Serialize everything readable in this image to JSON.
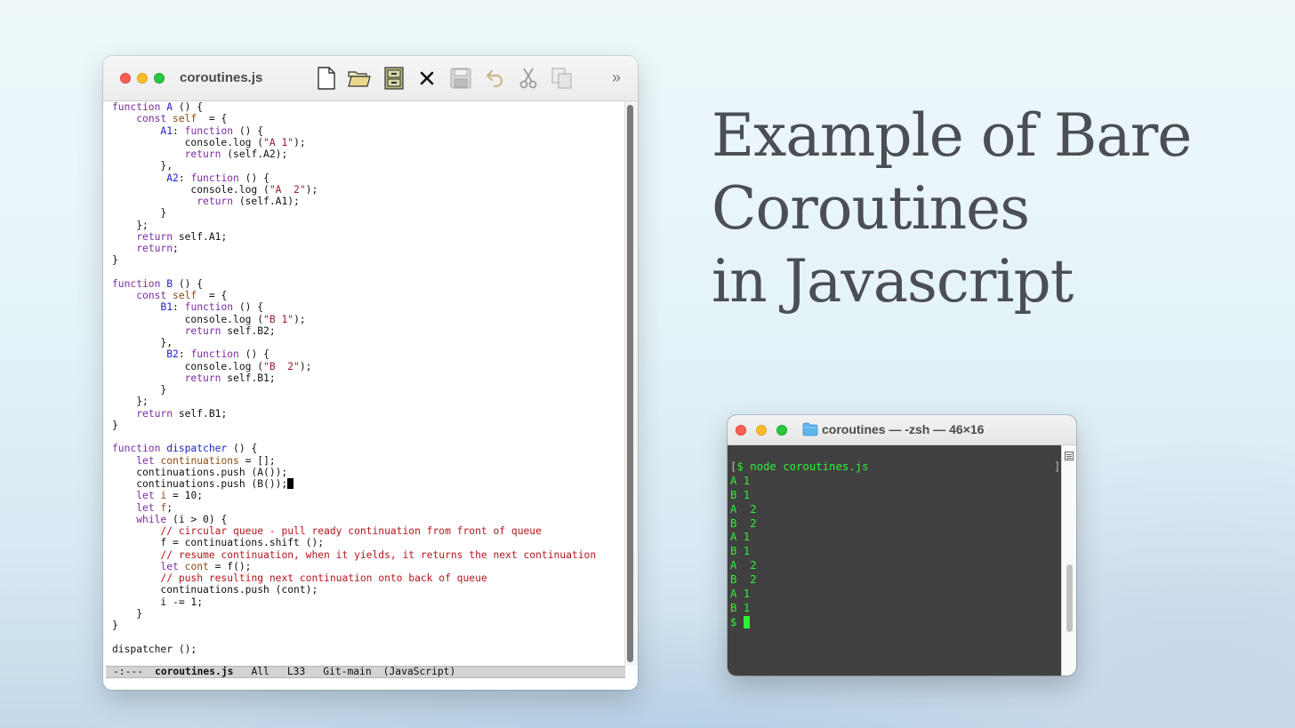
{
  "editor": {
    "title": "coroutines.js",
    "code_lines": [
      [
        [
          "kw",
          "function "
        ],
        [
          "fn",
          "A"
        ],
        [
          "",
          "  () {"
        ]
      ],
      [
        [
          "",
          "    "
        ],
        [
          "kw",
          "const "
        ],
        [
          "var",
          "self"
        ],
        [
          "",
          ""
        ],
        [
          "",
          ""
        ],
        [
          "",
          "  = {"
        ]
      ],
      [
        [
          "",
          "        "
        ],
        [
          "fn",
          "A1"
        ],
        [
          "",
          ": "
        ],
        [
          "kw",
          "function"
        ],
        [
          "",
          "  () {"
        ]
      ],
      [
        [
          "",
          "            console.log ("
        ],
        [
          "str",
          "\"A 1\""
        ],
        [
          "",
          ");"
        ]
      ],
      [
        [
          "",
          "            "
        ],
        [
          "kw",
          "return"
        ],
        [
          "",
          " (self.A2);"
        ]
      ],
      [
        [
          "",
          "        },"
        ]
      ],
      [
        [
          "",
          "         "
        ],
        [
          "fn",
          "A2"
        ],
        [
          "",
          ": "
        ],
        [
          "kw",
          "function"
        ],
        [
          "",
          "  () {"
        ]
      ],
      [
        [
          "",
          "             console.log ("
        ],
        [
          "str",
          "\"A  2\""
        ],
        [
          "",
          ");"
        ]
      ],
      [
        [
          "",
          "              "
        ],
        [
          "kw",
          "return"
        ],
        [
          "",
          " (self.A1);"
        ]
      ],
      [
        [
          "",
          "        }"
        ]
      ],
      [
        [
          "",
          "    };"
        ]
      ],
      [
        [
          "",
          "    "
        ],
        [
          "kw",
          "return"
        ],
        [
          "",
          " self.A1;"
        ]
      ],
      [
        [
          "",
          "    "
        ],
        [
          "kw",
          "return"
        ],
        [
          "",
          ";"
        ]
      ],
      [
        [
          "",
          "}"
        ]
      ],
      [
        [
          "",
          ""
        ]
      ],
      [
        [
          "kw",
          "function "
        ],
        [
          "fn",
          "B"
        ],
        [
          "",
          "  () {"
        ]
      ],
      [
        [
          "",
          "    "
        ],
        [
          "kw",
          "const "
        ],
        [
          "var",
          "self"
        ],
        [
          "",
          "  = {"
        ]
      ],
      [
        [
          "",
          "        "
        ],
        [
          "fn",
          "B1"
        ],
        [
          "",
          ": "
        ],
        [
          "kw",
          "function"
        ],
        [
          "",
          "  () {"
        ]
      ],
      [
        [
          "",
          "            console.log ("
        ],
        [
          "str",
          "\"B 1\""
        ],
        [
          "",
          ");"
        ]
      ],
      [
        [
          "",
          "            "
        ],
        [
          "kw",
          "return"
        ],
        [
          "",
          " self.B2;"
        ]
      ],
      [
        [
          "",
          "        },"
        ]
      ],
      [
        [
          "",
          "         "
        ],
        [
          "fn",
          "B2"
        ],
        [
          "",
          ": "
        ],
        [
          "kw",
          "function"
        ],
        [
          "",
          "  () {"
        ]
      ],
      [
        [
          "",
          "            console.log ("
        ],
        [
          "str",
          "\"B  2\""
        ],
        [
          "",
          ");"
        ]
      ],
      [
        [
          "",
          "            "
        ],
        [
          "kw",
          "return"
        ],
        [
          "",
          " self.B1;"
        ]
      ],
      [
        [
          "",
          "        }"
        ]
      ],
      [
        [
          "",
          "    };"
        ]
      ],
      [
        [
          "",
          "    "
        ],
        [
          "kw",
          "return"
        ],
        [
          "",
          " self.B1;"
        ]
      ],
      [
        [
          "",
          "}"
        ]
      ],
      [
        [
          "",
          ""
        ]
      ],
      [
        [
          "kw",
          "function "
        ],
        [
          "fn",
          "dispatcher"
        ],
        [
          "",
          "  () {"
        ]
      ],
      [
        [
          "",
          "    "
        ],
        [
          "kw",
          "let "
        ],
        [
          "var",
          "continuations"
        ],
        [
          "",
          " = [];"
        ]
      ],
      [
        [
          "",
          "    continuations.push (A());"
        ]
      ],
      [
        [
          "",
          "    continuations.push (B());"
        ],
        [
          "cursor",
          ""
        ]
      ],
      [
        [
          "",
          "    "
        ],
        [
          "kw",
          "let "
        ],
        [
          "var",
          "i"
        ],
        [
          "",
          " = 10;"
        ]
      ],
      [
        [
          "",
          "    "
        ],
        [
          "kw",
          "let "
        ],
        [
          "var",
          "f"
        ],
        [
          "",
          ";"
        ]
      ],
      [
        [
          "",
          "    "
        ],
        [
          "kw",
          "while"
        ],
        [
          "",
          " (i > 0) {"
        ]
      ],
      [
        [
          "",
          "        "
        ],
        [
          "cm",
          "// circular queue - pull ready continuation from front of queue"
        ]
      ],
      [
        [
          "",
          "        f = continuations.shift ();"
        ]
      ],
      [
        [
          "",
          "        "
        ],
        [
          "cm",
          "// resume continuation, when it yields, it returns the next continuation"
        ]
      ],
      [
        [
          "",
          "        "
        ],
        [
          "kw",
          "let "
        ],
        [
          "var",
          "cont"
        ],
        [
          "",
          " = f();"
        ]
      ],
      [
        [
          "",
          "        "
        ],
        [
          "cm",
          "// push resulting next continuation onto back of queue"
        ]
      ],
      [
        [
          "",
          "        continuations.push (cont);"
        ]
      ],
      [
        [
          "",
          "        i -= 1;"
        ]
      ],
      [
        [
          "",
          "    }"
        ]
      ],
      [
        [
          "",
          "}"
        ]
      ],
      [
        [
          "",
          ""
        ]
      ],
      [
        [
          "",
          "dispatcher ();"
        ]
      ]
    ],
    "modeline": {
      "status": "-:---",
      "buffer": "coroutines.js",
      "position": "All",
      "line": "L33",
      "branch": "Git-main",
      "mode": "(JavaScript)"
    }
  },
  "headline": {
    "line1": "Example of Bare",
    "line2": "Coroutines",
    "line3": "in Javascript"
  },
  "terminal": {
    "title": "coroutines — -zsh — 46×16",
    "command": "$ node coroutines.js",
    "output_lines": [
      "A 1",
      "B 1",
      "A  2",
      "B  2",
      "A 1",
      "B 1",
      "A  2",
      "B  2",
      "A 1",
      "B 1"
    ],
    "prompt": "$ "
  },
  "colors": {
    "keyword": "#7b2aa0",
    "function_name": "#2222c8",
    "string": "#9a1d2e",
    "variable": "#8a4a12",
    "comment": "#b3151a",
    "terminal_text": "#2ff03a",
    "terminal_bg": "#404040"
  }
}
